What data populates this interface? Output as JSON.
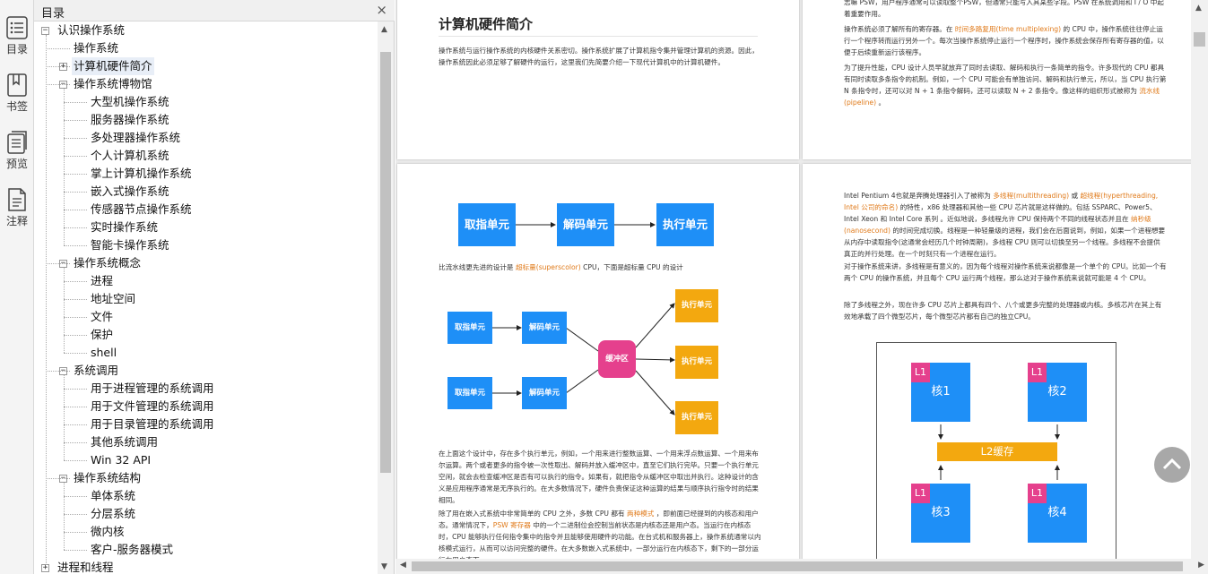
{
  "rail": {
    "items": [
      {
        "label": "目录",
        "icon": "toc-icon"
      },
      {
        "label": "书签",
        "icon": "bookmark-icon"
      },
      {
        "label": "预览",
        "icon": "preview-icon"
      },
      {
        "label": "注释",
        "icon": "annotation-icon"
      }
    ]
  },
  "toc": {
    "title": "目录",
    "close": "×",
    "items": [
      {
        "label": "认识操作系统",
        "level": 0,
        "exp": "minus"
      },
      {
        "label": "操作系统",
        "level": 1,
        "exp": ""
      },
      {
        "label": "计算机硬件简介",
        "level": 1,
        "exp": "plus",
        "selected": true
      },
      {
        "label": "操作系统博物馆",
        "level": 1,
        "exp": "minus"
      },
      {
        "label": "大型机操作系统",
        "level": 2,
        "exp": ""
      },
      {
        "label": "服务器操作系统",
        "level": 2,
        "exp": ""
      },
      {
        "label": "多处理器操作系统",
        "level": 2,
        "exp": ""
      },
      {
        "label": "个人计算机系统",
        "level": 2,
        "exp": ""
      },
      {
        "label": "掌上计算机操作系统",
        "level": 2,
        "exp": ""
      },
      {
        "label": "嵌入式操作系统",
        "level": 2,
        "exp": ""
      },
      {
        "label": "传感器节点操作系统",
        "level": 2,
        "exp": ""
      },
      {
        "label": "实时操作系统",
        "level": 2,
        "exp": ""
      },
      {
        "label": "智能卡操作系统",
        "level": 2,
        "exp": ""
      },
      {
        "label": "操作系统概念",
        "level": 1,
        "exp": "minus"
      },
      {
        "label": "进程",
        "level": 2,
        "exp": ""
      },
      {
        "label": "地址空间",
        "level": 2,
        "exp": ""
      },
      {
        "label": "文件",
        "level": 2,
        "exp": ""
      },
      {
        "label": "保护",
        "level": 2,
        "exp": ""
      },
      {
        "label": "shell",
        "level": 2,
        "exp": ""
      },
      {
        "label": "系统调用",
        "level": 1,
        "exp": "minus"
      },
      {
        "label": "用于进程管理的系统调用",
        "level": 2,
        "exp": ""
      },
      {
        "label": "用于文件管理的系统调用",
        "level": 2,
        "exp": ""
      },
      {
        "label": "用于目录管理的系统调用",
        "level": 2,
        "exp": ""
      },
      {
        "label": "其他系统调用",
        "level": 2,
        "exp": ""
      },
      {
        "label": "Win 32 API",
        "level": 2,
        "exp": ""
      },
      {
        "label": "操作系统结构",
        "level": 1,
        "exp": "minus"
      },
      {
        "label": "单体系统",
        "level": 2,
        "exp": ""
      },
      {
        "label": "分层系统",
        "level": 2,
        "exp": ""
      },
      {
        "label": "微内核",
        "level": 2,
        "exp": ""
      },
      {
        "label": "客户-服务器模式",
        "level": 2,
        "exp": ""
      },
      {
        "label": "进程和线程",
        "level": 0,
        "exp": "plus"
      }
    ]
  },
  "page1": {
    "title": "计算机硬件简介",
    "p1": "操作系统与运行操作系统的内核硬件关系密切。操作系统扩展了计算机指令集并管理计算机的资源。因此，操作系统因此必须足够了解硬件的运行，这里我们先简要介绍一下现代计算机中的计算机硬件。"
  },
  "page2": {
    "p0": "志嘛 PSW，用户程序通常可以读取整个PSW，但通常只能写入其某些字段。PSW 在系统调用和 I / O 中起着重要作用。",
    "p1a": "操作系统必须了解所有的寄存器。在 ",
    "p1hl": "时间多路复用(time multiplexing)",
    "p1b": " 的 CPU 中，操作系统往往停止运行一个程序转而运行另外一个。每次当操作系统停止运行一个程序时，操作系统会保存所有寄存器的值，以便于后续重新运行该程序。",
    "p2a": "为了提升性能，CPU 设计人员早就放弃了同时去读取、解码和执行一条简单的指令。许多现代的 CPU 都具有同时读取多条指令的机制。例如，一个 CPU 可能会有单独访问、解码和执行单元，所以，当 CPU 执行第 N 条指令时，还可以对 N + 1 条指令解码，还可以读取 N + 2 条指令。像这样的组织形式被称为 ",
    "p2hl": "流水线(pipeline)",
    "p2b": " 。"
  },
  "page3": {
    "pipe": [
      "取指单元",
      "解码单元",
      "执行单元"
    ],
    "cap_a": "比流水线更先进的设计是 ",
    "cap_hl": "超标量(superscolor)",
    "cap_b": " CPU，下面是超标量 CPU 的设计",
    "fetch": "取指单元",
    "decode": "解码单元",
    "buffer": "缓冲区",
    "exec": "执行单元",
    "p1": "在上面这个设计中，存在多个执行单元，例如，一个用来进行整数运算、一个用来浮点数运算、一个用来布尔运算。两个或者更多的指令被一次性取出、解码并放入缓冲区中，直至它们执行完毕。只要一个执行单元空闲，就会去检查缓冲区是否有可以执行的指令。如果有，就把指令从缓冲区中取出并执行。这种设计的含义是应用程序通常是无序执行的。在大多数情况下，硬件负责保证这种运算的结果与顺序执行指令时的结果相同。",
    "p2a": "除了用在嵌入式系统中非常简单的 CPU 之外，多数 CPU 都有 ",
    "p2hl1": "两种模式",
    "p2b": " ，即前面已经提到的内核态和用户态。通常情况下，",
    "p2hl2": "PSW 寄存器",
    "p2c": " 中的一个二进制位会控制当前状态是内核态还是用户态。当运行在内核态时，CPU 能够执行任何指令集中的指令并且能够使用硬件的功能。在台式机和服务器上，操作系统通常以内核模式运行，从而可以访问完整的硬件。在大多数嵌入式系统中，一部分运行在内核态下，剩下的一部分运行在用户态下。"
  },
  "page4": {
    "p1a": "Intel Pentium 4也就是奔腾处理器引入了被称为 ",
    "p1hl1": "多线程(multithreading)",
    "p1b": " 或 ",
    "p1hl2": "超线程(hyperthreading, Intel 公司的命名)",
    "p1c": " 的特性，x86 处理器和其他一些 CPU 芯片就是这样做的。包括 SSPARC、Power5、Intel Xeon 和 Intel Core 系列 。近似地说，多线程允许 CPU 保持两个不同的线程状态并且在 ",
    "p1hl3": "纳秒级(nanosecond)",
    "p1d": " 的时间完成切换。线程是一种轻量级的进程，我们会在后面说到，例如，如果一个进程想要从内存中读取指令(这通常会经历几个时钟周期)，多线程 CPU 则可以切换至另一个线程。多线程不会提供真正的并行处理。在一个时刻只有一个进程在运行。",
    "p2": "对于操作系统来讲，多线程是有意义的，因为每个线程对操作系统来说都像是一个单个的 CPU。比如一个有两个 CPU 的操作系统，并且每个 CPU 运行两个线程，那么这对于操作系统来说就可能是 4 个 CPU。",
    "p3": "除了多线程之外，现在许多 CPU 芯片上都具有四个、八个或更多完整的处理器或内核。多核芯片在其上有效地承载了四个微型芯片，每个微型芯片都有自己的独立CPU。",
    "l1": "L1",
    "cores": [
      "核1",
      "核2",
      "核3",
      "核4"
    ],
    "l2": "L2缓存"
  },
  "colors": {
    "blue": "#1e8ff7",
    "orange": "#f3a80f",
    "pink": "#e5408d",
    "highlight": "#e07a1a"
  }
}
